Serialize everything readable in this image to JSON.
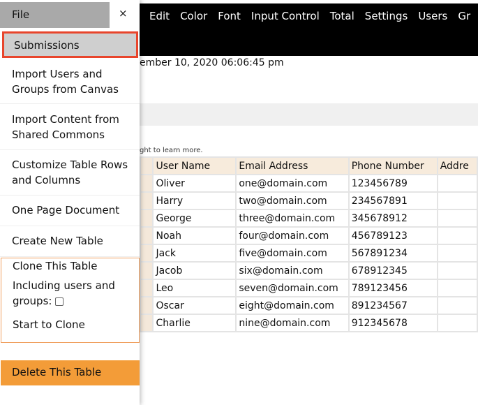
{
  "topnav": [
    "Edit",
    "Color",
    "Font",
    "Input Control",
    "Total",
    "Settings",
    "Users",
    "Gr"
  ],
  "date_text": "ember 10, 2020 06:06:45 pm",
  "hint_text": "ght to learn more.",
  "table": {
    "headers": [
      "User Name",
      "Email Address",
      "Phone Number",
      "Addre"
    ],
    "rows": [
      [
        "Oliver",
        "one@domain.com",
        "123456789"
      ],
      [
        "Harry",
        "two@domain.com",
        "234567891"
      ],
      [
        "George",
        "three@domain.com",
        "345678912"
      ],
      [
        "Noah",
        "four@domain.com",
        "456789123"
      ],
      [
        "Jack",
        "five@domain.com",
        "567891234"
      ],
      [
        "Jacob",
        "six@domain.com",
        "678912345"
      ],
      [
        "Leo",
        "seven@domain.com",
        "789123456"
      ],
      [
        "Oscar",
        "eight@domain.com",
        "891234567"
      ],
      [
        "Charlie",
        "nine@domain.com",
        "912345678"
      ]
    ]
  },
  "menu": {
    "file": "File",
    "close": "×",
    "submissions": "Submissions",
    "import_users": "Import Users and Groups from Canvas",
    "import_content": "Import Content from Shared Commons",
    "customize": "Customize Table Rows and Columns",
    "one_page": "One Page Document",
    "create": "Create New Table",
    "clone_title": "Clone This Table",
    "including": "Including users and groups:",
    "start_clone": "Start to Clone",
    "delete": "Delete This Table"
  },
  "colors": {
    "highlight_border": "#e8452c",
    "delete_bg": "#f39c38",
    "header_bg": "#f7ebdc"
  }
}
